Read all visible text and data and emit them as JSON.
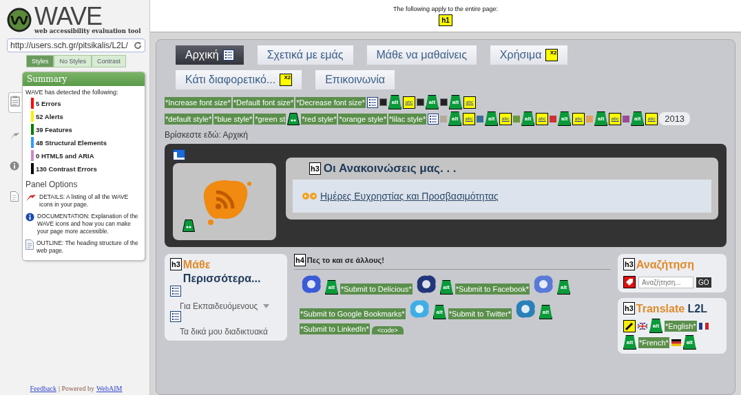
{
  "sidebar": {
    "logo": {
      "title": "WAVE",
      "subtitle": "web accessibility evaluation tool"
    },
    "url": "http://users.sch.gr/pitsikalis/L2L/",
    "views": [
      {
        "label": "Styles",
        "selected": true
      },
      {
        "label": "No Styles",
        "selected": false
      },
      {
        "label": "Contrast",
        "selected": false
      }
    ],
    "side_tabs": [
      {
        "kind": "summary",
        "selected": true
      },
      {
        "kind": "details",
        "selected": false
      },
      {
        "kind": "documentation",
        "selected": false
      },
      {
        "kind": "outline",
        "selected": false
      }
    ],
    "summary": {
      "title": "Summary",
      "intro": "WAVE has detected the following:",
      "items": [
        {
          "label": "5 Errors",
          "color": "#ff0000"
        },
        {
          "label": "52 Alerts",
          "color": "#ffee00"
        },
        {
          "label": "39 Features",
          "color": "#008000"
        },
        {
          "label": "48 Structural Elements",
          "color": "#3399ff"
        },
        {
          "label": "0 HTML5 and ARIA",
          "color": "#cc88cc"
        },
        {
          "label": "130 Contrast Errors",
          "color": "#000000"
        }
      ],
      "options_title": "Panel Options",
      "options": [
        {
          "kind": "details",
          "text": "DETAILS: A listing of all the WAVE icons in your page."
        },
        {
          "kind": "documentation",
          "text": "DOCUMENTATION: Explanation of the WAVE icons and how you can make your page more accessible."
        },
        {
          "kind": "outline",
          "text": "OUTLINE: The heading structure of the web page."
        }
      ]
    },
    "footer": {
      "feedback": "Feedback",
      "separator": "| Powered by",
      "webaim": "WebAIM"
    }
  },
  "header": {
    "note": "The following apply to the entire page:",
    "badge": "h1"
  },
  "site": {
    "nav": [
      {
        "label": "Αρχική",
        "selected": true,
        "markers": [
          {
            "kind": "list"
          }
        ]
      },
      {
        "label": "Σχετικά με εμάς",
        "selected": false
      },
      {
        "label": "Μάθε να μαθαίνεις",
        "selected": false
      },
      {
        "label": "Χρήσιμα",
        "selected": false,
        "markers": [
          {
            "kind": "x2",
            "label": "X2"
          }
        ]
      },
      {
        "label": "Κάτι διαφορετικό...",
        "selected": false,
        "markers": [
          {
            "kind": "x2",
            "label": "X2"
          }
        ]
      },
      {
        "label": "Επικοινωνία",
        "selected": false
      }
    ],
    "tool_rows": [
      [
        {
          "kind": "label",
          "text": "*Increase font size*"
        },
        {
          "kind": "label",
          "text": "*Default font size*"
        },
        {
          "kind": "label",
          "text": "*Decrease font size*"
        },
        {
          "kind": "list"
        },
        {
          "kind": "img"
        },
        {
          "kind": "alt",
          "label": "alt"
        },
        {
          "kind": "abc",
          "label": "abc"
        },
        {
          "kind": "img"
        },
        {
          "kind": "alt",
          "label": "alt"
        },
        {
          "kind": "img"
        },
        {
          "kind": "alt",
          "label": "alt"
        },
        {
          "kind": "abc",
          "label": "abc"
        }
      ],
      [
        {
          "kind": "label",
          "text": "*default style*"
        },
        {
          "kind": "label",
          "text": "*blue style*"
        },
        {
          "kind": "label",
          "text": "*green st"
        },
        {
          "kind": "quote"
        },
        {
          "kind": "label",
          "text": "*red style*"
        },
        {
          "kind": "label",
          "text": "*orange style*"
        },
        {
          "kind": "label",
          "text": "*lilac style*"
        },
        {
          "kind": "list"
        },
        {
          "kind": "swatch",
          "color": "#b8a898"
        },
        {
          "kind": "alt",
          "label": "alt"
        },
        {
          "kind": "abc",
          "label": "abc"
        },
        {
          "kind": "swatch",
          "color": "#3a6e9a"
        },
        {
          "kind": "alt",
          "label": "alt"
        },
        {
          "kind": "abc",
          "label": "abc"
        },
        {
          "kind": "swatch",
          "color": "#6a9a3a"
        },
        {
          "kind": "alt",
          "label": "alt"
        },
        {
          "kind": "abc",
          "label": "abc"
        },
        {
          "kind": "swatch",
          "color": "#d03030"
        },
        {
          "kind": "alt",
          "label": "alt"
        },
        {
          "kind": "abc",
          "label": "abc"
        },
        {
          "kind": "swatch",
          "color": "#e0a060"
        },
        {
          "kind": "alt",
          "label": "alt"
        },
        {
          "kind": "abc",
          "label": "abc"
        },
        {
          "kind": "swatch",
          "color": "#9a4a9a"
        },
        {
          "kind": "alt",
          "label": "alt"
        },
        {
          "kind": "abc",
          "label": "abc"
        },
        {
          "kind": "text",
          "text": "2013"
        }
      ]
    ],
    "breadcrumb": "Βρίσκεστε εδώ: Αρχική",
    "announcements": {
      "badge": "h3",
      "title": "Οι Ανακοινώσεις μας. . .",
      "link": "Ημέρες Ευχρηστίας και Προσβασιμότητας"
    },
    "learn_more": {
      "badge": "h3",
      "heading": [
        {
          "text": "Μάθε",
          "accent": true
        },
        {
          "text": "Περισσότερα...",
          "accent": false
        }
      ],
      "items": [
        {
          "text": "Για Εκπαιδευόμενους",
          "has_submenu": true
        },
        {
          "text": "Τα δικά μου διαδικτυακά",
          "has_submenu": false
        }
      ]
    },
    "share": {
      "badge": "h4",
      "title": "Πες το και σε άλλους!",
      "items": [
        {
          "kind": "delicious"
        },
        {
          "kind": "alt",
          "label": "alt"
        },
        {
          "kind": "label",
          "text": "*Submit to Delicious*"
        },
        {
          "kind": "facebook"
        },
        {
          "kind": "alt",
          "label": "alt"
        },
        {
          "kind": "label",
          "text": "*Submit to Facebook*"
        },
        {
          "kind": "google"
        },
        {
          "kind": "alt",
          "label": "alt"
        },
        {
          "kind": "label",
          "text": "*Submit to Google Bookmarks*"
        },
        {
          "kind": "twitter"
        },
        {
          "kind": "alt",
          "label": "alt"
        },
        {
          "kind": "label",
          "text": "*Submit to Twitter*"
        },
        {
          "kind": "linkedin"
        },
        {
          "kind": "alt",
          "label": "alt"
        },
        {
          "kind": "label",
          "text": "*Submit to LinkedIn*"
        },
        {
          "kind": "code",
          "text": "<code>"
        }
      ]
    },
    "search": {
      "badge": "h3",
      "heading": [
        {
          "text": "Αναζήτηση",
          "accent": true
        }
      ],
      "placeholder": "Αναζήτηση...",
      "button": "GO"
    },
    "translate": {
      "badge": "h3",
      "heading": [
        {
          "text": "Translate",
          "accent": true
        },
        {
          "text": "L2L",
          "accent": false
        }
      ],
      "items": [
        {
          "kind": "edit"
        },
        {
          "kind": "uk"
        },
        {
          "kind": "alt",
          "label": "alt"
        },
        {
          "kind": "label",
          "text": "*English*"
        },
        {
          "kind": "fr"
        },
        {
          "kind": "alt",
          "label": "alt"
        },
        {
          "kind": "label",
          "text": "*French*"
        },
        {
          "kind": "de"
        },
        {
          "kind": "alt",
          "label": "alt"
        }
      ]
    }
  }
}
